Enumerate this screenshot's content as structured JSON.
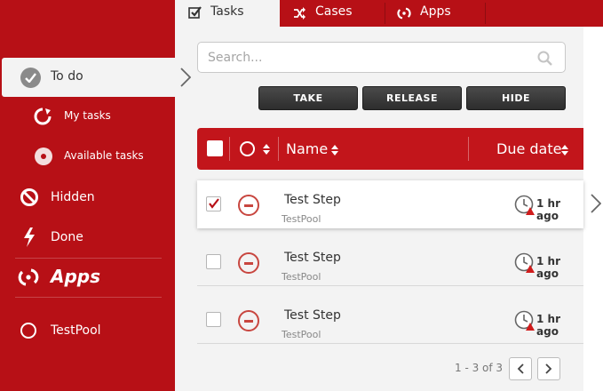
{
  "tabs": [
    {
      "label": "Tasks",
      "icon": "checkbox-icon",
      "active": true
    },
    {
      "label": "Cases",
      "icon": "shuffle-icon"
    },
    {
      "label": "Apps",
      "icon": "apps-icon"
    }
  ],
  "sidebar": {
    "todo_label": "To do",
    "my_tasks_label": "My tasks",
    "available_tasks_label": "Available tasks",
    "hidden_label": "Hidden",
    "done_label": "Done",
    "apps_label": "Apps",
    "pool_label": "TestPool"
  },
  "search": {
    "placeholder": "Search...",
    "value": ""
  },
  "actions": {
    "take": "TAKE",
    "release": "RELEASE",
    "hide": "HIDE"
  },
  "table": {
    "col_name": "Name",
    "col_due": "Due date",
    "rows": [
      {
        "name": "Test Step",
        "pool": "TestPool",
        "due": "1 hr ago",
        "checked": true
      },
      {
        "name": "Test Step",
        "pool": "TestPool",
        "due": "1 hr ago",
        "checked": false
      },
      {
        "name": "Test Step",
        "pool": "TestPool",
        "due": "1 hr ago",
        "checked": false
      }
    ]
  },
  "pager": {
    "text": "1 - 3 of 3"
  },
  "colors": {
    "brand": "#b71016",
    "header": "#c2151b",
    "accent_icon": "#c8463f"
  }
}
